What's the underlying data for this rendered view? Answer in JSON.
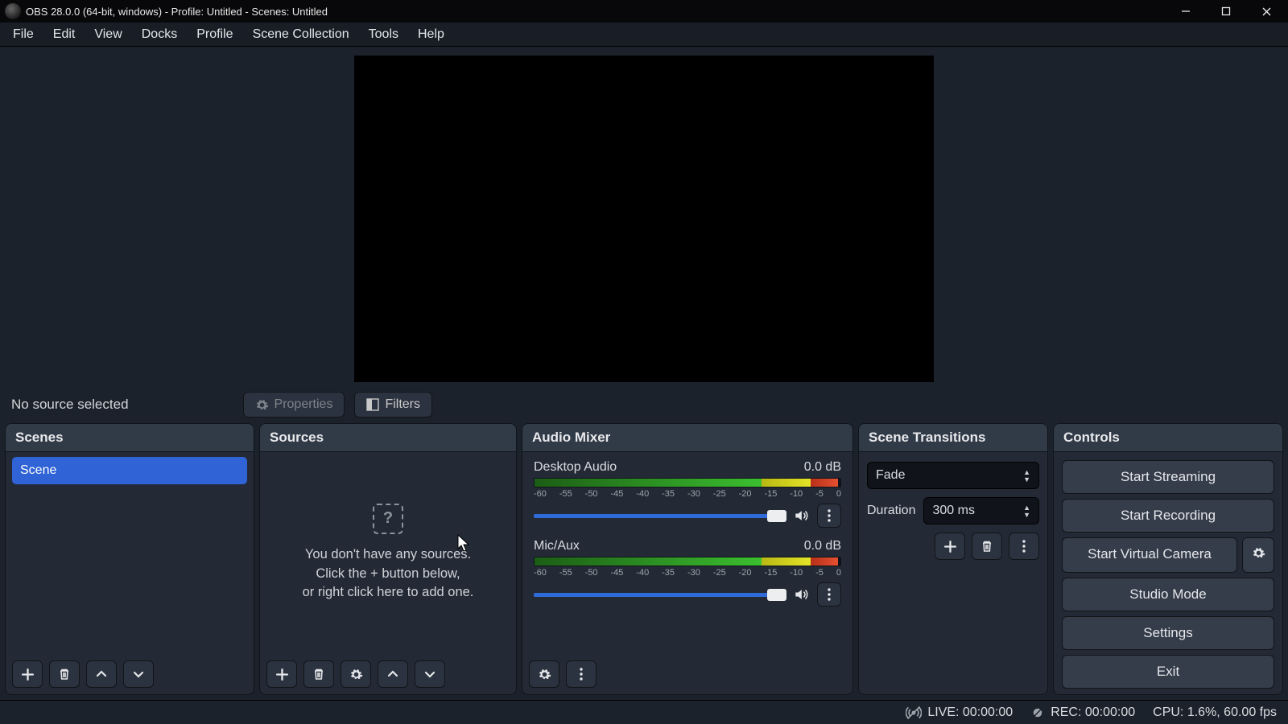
{
  "title": "OBS 28.0.0 (64-bit, windows) - Profile: Untitled - Scenes: Untitled",
  "menus": [
    "File",
    "Edit",
    "View",
    "Docks",
    "Profile",
    "Scene Collection",
    "Tools",
    "Help"
  ],
  "toolbar": {
    "selection": "No source selected",
    "properties": "Properties",
    "filters": "Filters"
  },
  "panels": {
    "scenes": {
      "title": "Scenes",
      "items": [
        "Scene"
      ]
    },
    "sources": {
      "title": "Sources",
      "empty1": "You don't have any sources.",
      "empty2": "Click the + button below,",
      "empty3": "or right click here to add one."
    },
    "mixer": {
      "title": "Audio Mixer",
      "ch1": {
        "name": "Desktop Audio",
        "db": "0.0 dB"
      },
      "ch2": {
        "name": "Mic/Aux",
        "db": "0.0 dB"
      },
      "ticks": [
        "-60",
        "-55",
        "-50",
        "-45",
        "-40",
        "-35",
        "-30",
        "-25",
        "-20",
        "-15",
        "-10",
        "-5",
        "0"
      ]
    },
    "transitions": {
      "title": "Scene Transitions",
      "current": "Fade",
      "durationLabel": "Duration",
      "duration": "300 ms"
    },
    "controls": {
      "title": "Controls",
      "startStreaming": "Start Streaming",
      "startRecording": "Start Recording",
      "startVirtualCam": "Start Virtual Camera",
      "studioMode": "Studio Mode",
      "settings": "Settings",
      "exit": "Exit"
    }
  },
  "status": {
    "live": "LIVE: 00:00:00",
    "rec": "REC: 00:00:00",
    "cpu": "CPU: 1.6%, 60.00 fps"
  }
}
